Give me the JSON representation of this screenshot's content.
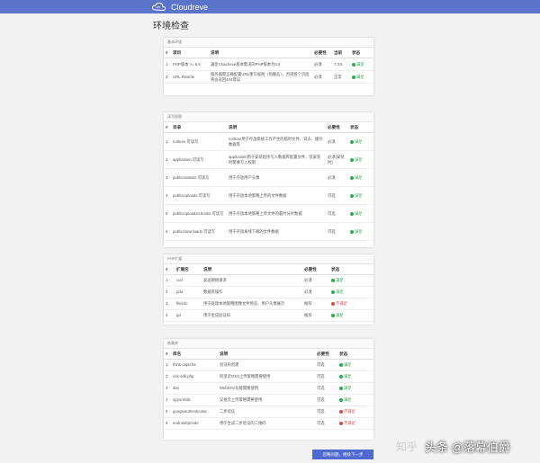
{
  "header": {
    "brand": "Cloudreve"
  },
  "page": {
    "title": "环境检查"
  },
  "sections": {
    "basic": {
      "title": "基本环境",
      "headers": [
        "#",
        "项目",
        "说明",
        "必要性",
        "当前",
        "状态"
      ],
      "rows": [
        {
          "num": "1",
          "item": "PHP版本 >= 5.6",
          "desc": "满足Cloudreve基本需求的PHP版本为5.6",
          "req": "必须",
          "current": "7.3.5",
          "status": "满足",
          "ok": true
        },
        {
          "num": "2",
          "item": "URL Rewrite",
          "desc": "服务器需正确配置URL重写规则（伪静态），否则各个页面将会返回404错误",
          "req": "必须",
          "current": "正常",
          "status": "满足",
          "ok": true
        }
      ]
    },
    "perms": {
      "title": "读写权限",
      "headers": [
        "#",
        "目录",
        "说明",
        "必要性",
        "状态"
      ],
      "rows": [
        {
          "num": "1",
          "item": "runtime 可读写",
          "desc": "runtime用于存放系统工作产生的临时文件、日志、缓存数据等",
          "req": "必须",
          "status": "满足",
          "ok": true
        },
        {
          "num": "2",
          "item": "application 可读写",
          "desc": "application用于安装程序写入数据库配置文件，仅安装时需要写入权限",
          "req": "必须(安装时)",
          "status": "满足",
          "ok": true
        },
        {
          "num": "3",
          "item": "public/avatars 可读写",
          "desc": "用于存放用户头像",
          "req": "必须",
          "status": "满足",
          "ok": true
        },
        {
          "num": "4",
          "item": "public/uploads 可读写",
          "desc": "用于存放本地策略上传的文件数据",
          "req": "可选",
          "status": "满足",
          "ok": true
        },
        {
          "num": "5",
          "item": "public/uploads/chunks 可读写",
          "desc": "用于存放本地策略上传文件的临时分片数据",
          "req": "可选",
          "status": "满足",
          "ok": true
        },
        {
          "num": "6",
          "item": "public/downloads 可读写",
          "desc": "用于存放离线下载的文件数据",
          "req": "可选",
          "status": "满足",
          "ok": true
        }
      ]
    },
    "php_ext": {
      "title": "PHP扩展",
      "headers": [
        "#",
        "扩展名",
        "说明",
        "必要性",
        "状态"
      ],
      "rows": [
        {
          "num": "1",
          "item": "curl",
          "desc": "发送网络请求",
          "req": "必须",
          "status": "满足",
          "ok": true
        },
        {
          "num": "2",
          "item": "pdo",
          "desc": "数据库操作",
          "req": "必须",
          "status": "满足",
          "ok": true
        },
        {
          "num": "3",
          "item": "fileinfo",
          "desc": "用于处理本地策略图像文件预览、用户头像展示",
          "req": "推荐",
          "status": "不满足",
          "ok": false
        },
        {
          "num": "4",
          "item": "gd",
          "desc": "用于生成验证码",
          "req": "推荐",
          "status": "满足",
          "ok": true
        }
      ]
    },
    "deps": {
      "title": "依赖库",
      "headers": [
        "#",
        "库名",
        "说明",
        "必要性",
        "状态"
      ],
      "rows": [
        {
          "num": "1",
          "item": "think-captcha",
          "desc": "验证码创建",
          "req": "可选",
          "status": "满足",
          "ok": true
        },
        {
          "num": "2",
          "item": "oss-sdk-php",
          "desc": "阿里云OSS上传策略需要使用",
          "req": "可选",
          "status": "满足",
          "ok": true
        },
        {
          "num": "3",
          "item": "dav",
          "desc": "WebDAV功能需要使用",
          "req": "可选",
          "status": "满足",
          "ok": true
        },
        {
          "num": "4",
          "item": "upyun/sdk",
          "desc": "又拍云上传策略需要使用",
          "req": "可选",
          "status": "满足",
          "ok": true
        },
        {
          "num": "5",
          "item": "googleauthenticator",
          "desc": "二步验证",
          "req": "可选",
          "status": "不满足",
          "ok": false
        },
        {
          "num": "6",
          "item": "endroid/qrcode",
          "desc": "用于生成二步验证的二维码",
          "req": "可选",
          "status": "不满足",
          "ok": false
        }
      ]
    }
  },
  "actions": {
    "next_label": "忽略问题，继续下一步"
  },
  "watermark": {
    "source": "知乎",
    "text": "头条 @落幕伯爵"
  },
  "colors": {
    "topbar": "#5b73c8",
    "ok": "#2eaa55",
    "bad": "#e04848",
    "button": "#4f6ad0"
  }
}
